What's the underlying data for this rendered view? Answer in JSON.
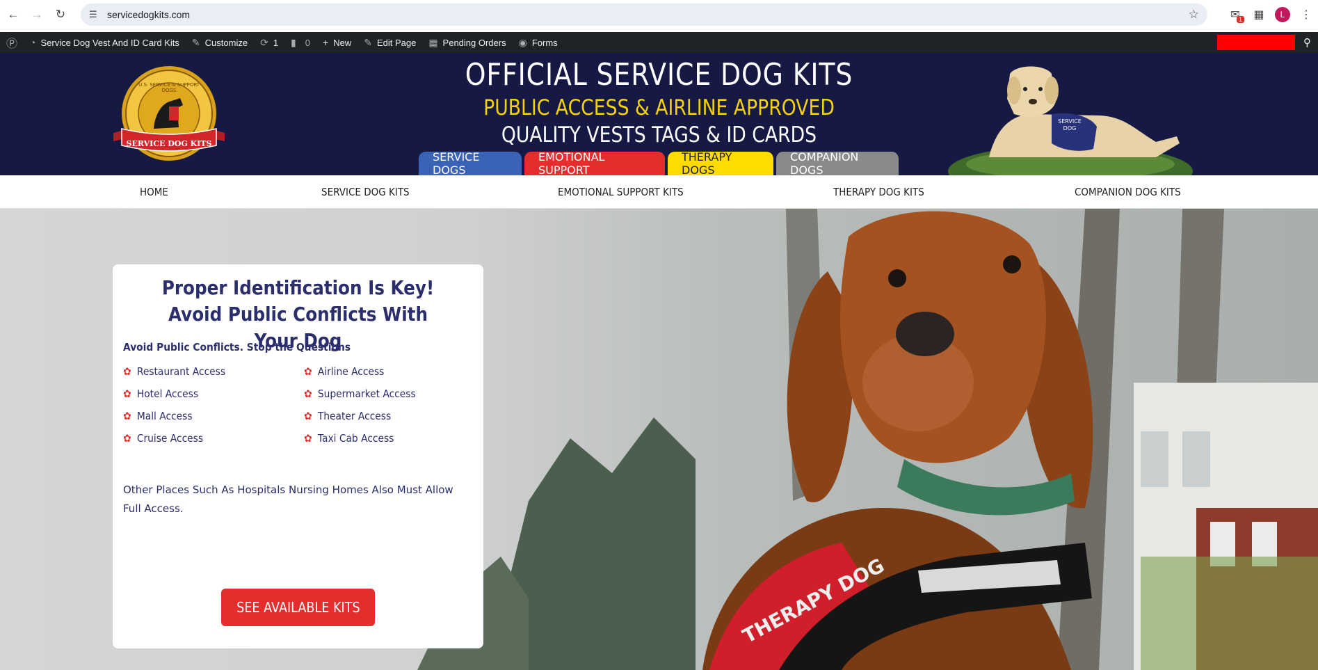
{
  "browser": {
    "url": "servicedogkits.com",
    "extension_badge": "1",
    "profile_initial": "L"
  },
  "admin_bar": {
    "site_name": "Service Dog Vest And ID Card Kits",
    "customize": "Customize",
    "updates_count": "1",
    "comments_count": "0",
    "new": "New",
    "edit_page": "Edit Page",
    "pending_orders": "Pending Orders",
    "forms": "Forms"
  },
  "header": {
    "logo_text_top": "U.S. SERVICE & SUPPORT DOGS",
    "logo_ribbon": "SERVICE DOG KITS",
    "title": "OFFICIAL SERVICE DOG KITS",
    "subtitle1": "PUBLIC ACCESS & AIRLINE APPROVED",
    "subtitle2": "QUALITY VESTS TAGS & ID CARDS",
    "tabs": [
      "SERVICE DOGS",
      "EMOTIONAL SUPPORT",
      "THERAPY DOGS",
      "COMPANION DOGS"
    ],
    "vest_text": "SERVICE DOG"
  },
  "nav": {
    "items": [
      "HOME",
      "SERVICE DOG KITS",
      "EMOTIONAL SUPPORT KITS",
      "THERAPY DOG KITS",
      "COMPANION DOG KITS"
    ]
  },
  "hero": {
    "card_title": "Proper Identification Is Key! Avoid Public Conflicts With Your Dog",
    "card_subtitle": "Avoid Public Conflicts. Stop the Questions",
    "access": [
      "Restaurant Access",
      "Airline Access",
      "Hotel Access",
      "Supermarket Access",
      "Mall Access",
      "Theater Access",
      "Cruise Access",
      "Taxi Cab Access"
    ],
    "note": "Other Places Such As Hospitals Nursing Homes Also Must Allow Full Access.",
    "cta": "SEE AVAILABLE KITS",
    "harness_text": "THERAPY DOG"
  },
  "colors": {
    "header_bg": "#151944",
    "accent_yellow": "#f5d10b",
    "accent_red": "#e52d2d",
    "accent_blue": "#3a62b5",
    "text_navy": "#2b2e6c"
  }
}
